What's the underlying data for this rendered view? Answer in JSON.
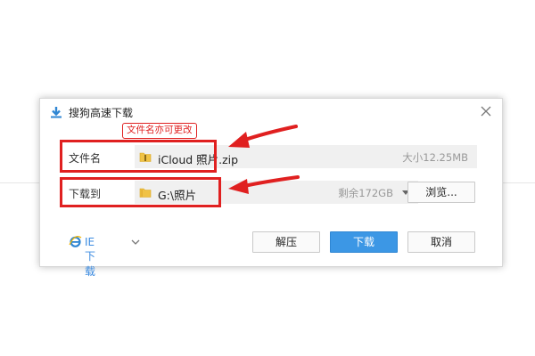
{
  "dialog": {
    "title": "搜狗高速下载",
    "filename_label": "文件名",
    "filename_value": "iCloud 照片.zip",
    "size_text": "大小12.25MB",
    "download_to_label": "下载到",
    "path_value": "G:\\照片",
    "free_space_text": "剩余172GB",
    "browse_label": "浏览...",
    "ie_download_label": "IE下载",
    "extract_label": "解压",
    "download_label": "下载",
    "cancel_label": "取消"
  },
  "annotation": {
    "note_text": "文件名亦可更改",
    "highlight_color": "#e02020"
  },
  "colors": {
    "primary_button": "#3c97e5",
    "link": "#3a8ae0"
  }
}
